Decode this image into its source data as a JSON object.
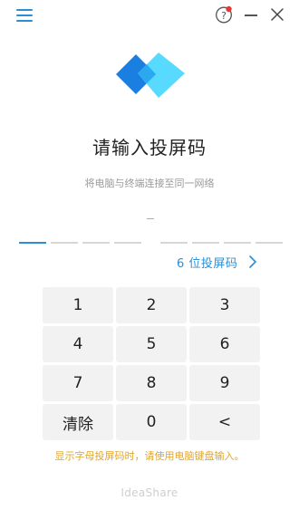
{
  "titlebar": {
    "menu_icon": "hamburger-menu-icon",
    "help_icon": "help-question-icon",
    "help_badge_color": "#e53935",
    "minimize_icon": "minimize-icon",
    "close_icon": "close-icon"
  },
  "logo": {
    "icon": "ideashare-diamond-logo",
    "colors": [
      "#1a7fe0",
      "#4fd8ff"
    ]
  },
  "title": "请输入投屏码",
  "subtitle": "将电脑与终端连接至同一网络",
  "code": {
    "separator": "–",
    "slots": 8,
    "active_slot": 1
  },
  "code_length_selector": {
    "label": "6 位投屏码",
    "icon": "chevron-right-icon"
  },
  "keypad": {
    "keys": [
      "1",
      "2",
      "3",
      "4",
      "5",
      "6",
      "7",
      "8",
      "9",
      "清除",
      "0",
      "<"
    ]
  },
  "hint": "显示字母投屏码时，请使用电脑键盘输入。",
  "brand": "IdeaShare",
  "colors": {
    "accent": "#2a8fd6",
    "hint": "#e0a52a",
    "key_bg": "#f2f2f2"
  }
}
